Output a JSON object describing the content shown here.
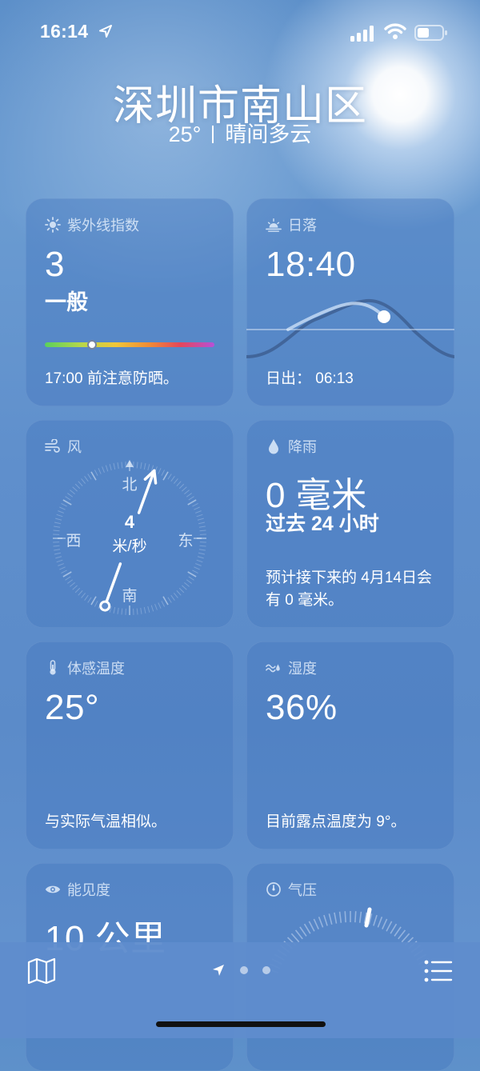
{
  "status_bar": {
    "time": "16:14"
  },
  "header": {
    "city": "深圳市南山区",
    "temperature": "25°",
    "condition": "晴间多云"
  },
  "cards": {
    "uv": {
      "title": "紫外线指数",
      "value": "3",
      "level": "一般",
      "note": "17:00 前注意防晒。",
      "bar_position_fraction": 0.28
    },
    "sunset": {
      "title": "日落",
      "value": "18:40",
      "sunrise_label": "日出：",
      "sunrise_time": "06:13"
    },
    "wind": {
      "title": "风",
      "speed": "4",
      "unit": "米/秒",
      "north": "北",
      "south": "南",
      "east": "东",
      "west": "西",
      "direction_degrees": 20
    },
    "rain": {
      "title": "降雨",
      "value": "0 毫米",
      "period": "过去 24 小时",
      "note": "预计接下来的 4月14日会有 0 毫米。"
    },
    "feels_like": {
      "title": "体感温度",
      "value": "25°",
      "note": "与实际气温相似。"
    },
    "humidity": {
      "title": "湿度",
      "value": "36%",
      "note": "目前露点温度为 9°。"
    },
    "visibility": {
      "title": "能见度",
      "value": "10 公里"
    },
    "pressure": {
      "title": "气压"
    }
  },
  "tab_bar": {
    "map_icon": "map-icon",
    "list_icon": "list-icon",
    "location_icon": "location-arrow-icon"
  },
  "colors": {
    "uv_gradient": [
      "#5ad15c",
      "#b9d74a",
      "#f0c63a",
      "#f08a35",
      "#e4465b",
      "#b651d8"
    ]
  }
}
